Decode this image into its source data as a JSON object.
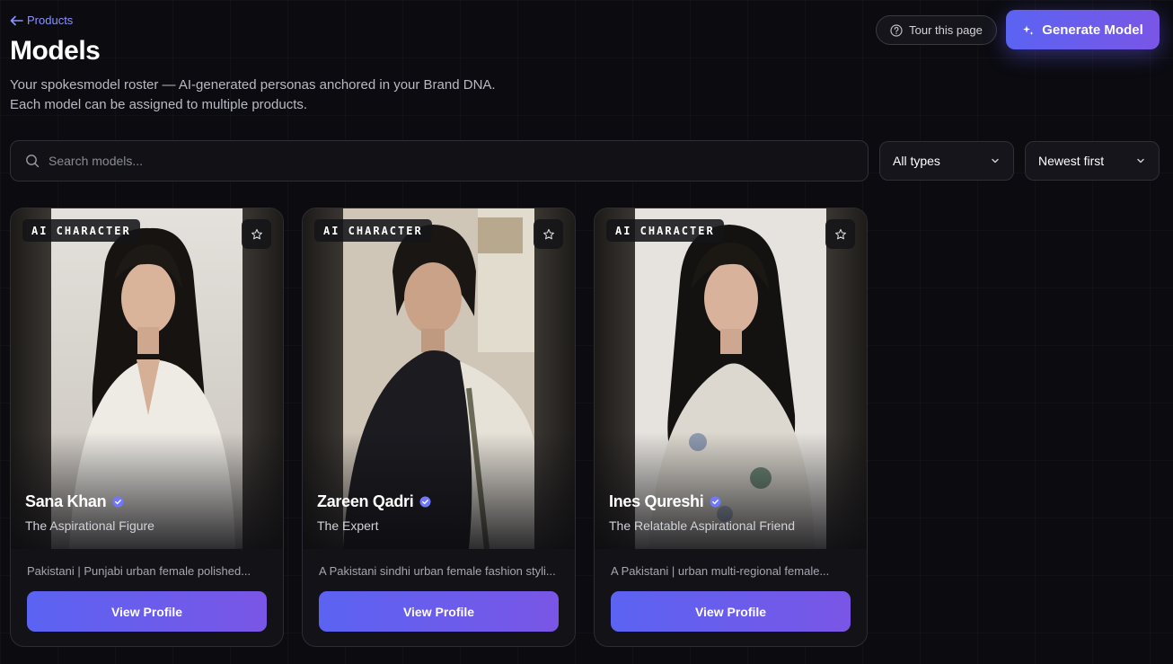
{
  "nav": {
    "back_label": "Products"
  },
  "header": {
    "title": "Models",
    "subtitle_line1": "Your spokesmodel roster — AI-generated personas anchored in your Brand DNA.",
    "subtitle_line2": "Each model can be assigned to multiple products.",
    "tour_label": "Tour this page",
    "generate_label": "Generate Model"
  },
  "filters": {
    "search_placeholder": "Search models...",
    "type_value": "All types",
    "sort_value": "Newest first"
  },
  "models": [
    {
      "badge": "AI CHARACTER",
      "name": "Sana Khan",
      "role": "The Aspirational Figure",
      "description": "Pakistani | Punjabi urban female polished...",
      "button": "View Profile"
    },
    {
      "badge": "AI CHARACTER",
      "name": "Zareen Qadri",
      "role": "The Expert",
      "description": "A Pakistani sindhi urban female fashion styli...",
      "button": "View Profile"
    },
    {
      "badge": "AI CHARACTER",
      "name": "Ines Qureshi",
      "role": "The Relatable Aspirational Friend",
      "description": "A Pakistani | urban multi-regional female...",
      "button": "View Profile"
    }
  ],
  "colors": {
    "accent": "#5b63f2",
    "accent_end": "#7a56e6",
    "link": "#8b93ff",
    "verified": "#6f78ff",
    "background": "#0b0b10"
  },
  "icons": {
    "back": "arrow-left-icon",
    "tour": "question-circle-icon",
    "generate": "sparkle-icon",
    "search": "search-icon",
    "dropdown": "chevron-down-icon",
    "favorite": "star-icon",
    "verified": "verified-badge-icon"
  }
}
